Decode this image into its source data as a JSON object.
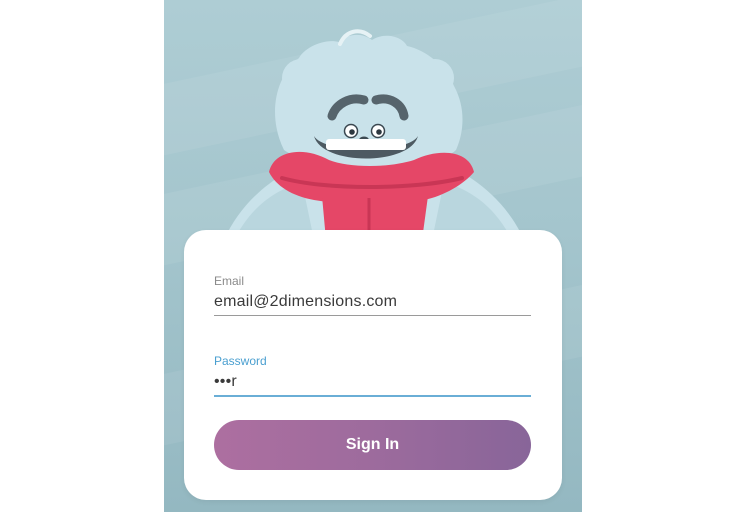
{
  "colors": {
    "background": "#a4c5cd",
    "card": "#ffffff",
    "button_start": "#ad6fa0",
    "button_end": "#886599",
    "focus_accent": "#4a9fd0",
    "scarf": "#e54767",
    "bear_fur": "#c9e2ea"
  },
  "mascot": {
    "icon": "teddy-bear-icon"
  },
  "form": {
    "email": {
      "label": "Email",
      "value": "email@2dimensions.com"
    },
    "password": {
      "label": "Password",
      "value": "•••r"
    },
    "sign_in_label": "Sign In"
  }
}
